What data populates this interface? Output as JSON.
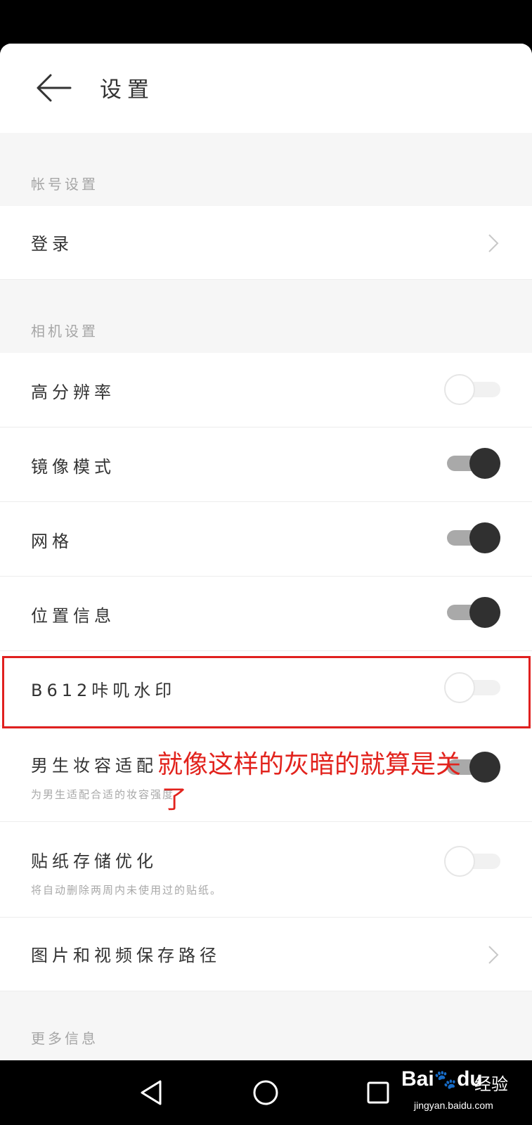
{
  "header": {
    "title": "设置"
  },
  "sections": {
    "account": {
      "title": "帐号设置",
      "login_label": "登录"
    },
    "camera": {
      "title": "相机设置",
      "items": [
        {
          "label": "高分辨率",
          "state": "off"
        },
        {
          "label": "镜像模式",
          "state": "on"
        },
        {
          "label": "网格",
          "state": "on"
        },
        {
          "label": "位置信息",
          "state": "on"
        },
        {
          "label": "B612咔叽水印",
          "state": "off"
        }
      ],
      "makeup": {
        "label": "男生妆容适配",
        "sub": "为男生适配合适的妆容强度",
        "state": "on"
      },
      "sticker": {
        "label": "贴纸存储优化",
        "sub": "将自动删除两周内未使用过的贴纸。",
        "state": "off"
      },
      "save_path_label": "图片和视频保存路径"
    },
    "more": {
      "title": "更多信息"
    }
  },
  "annotation": {
    "line1": "就像这样的灰暗的就算是关",
    "line2": "了"
  },
  "watermark": {
    "logo": "Bai",
    "logo_suffix": "du",
    "jingyan": "经验",
    "url": "jingyan.baidu.com"
  },
  "colors": {
    "toggle_on_knob": "#303030",
    "toggle_on_track": "#a9a9a9",
    "annotation": "#e2231d"
  }
}
